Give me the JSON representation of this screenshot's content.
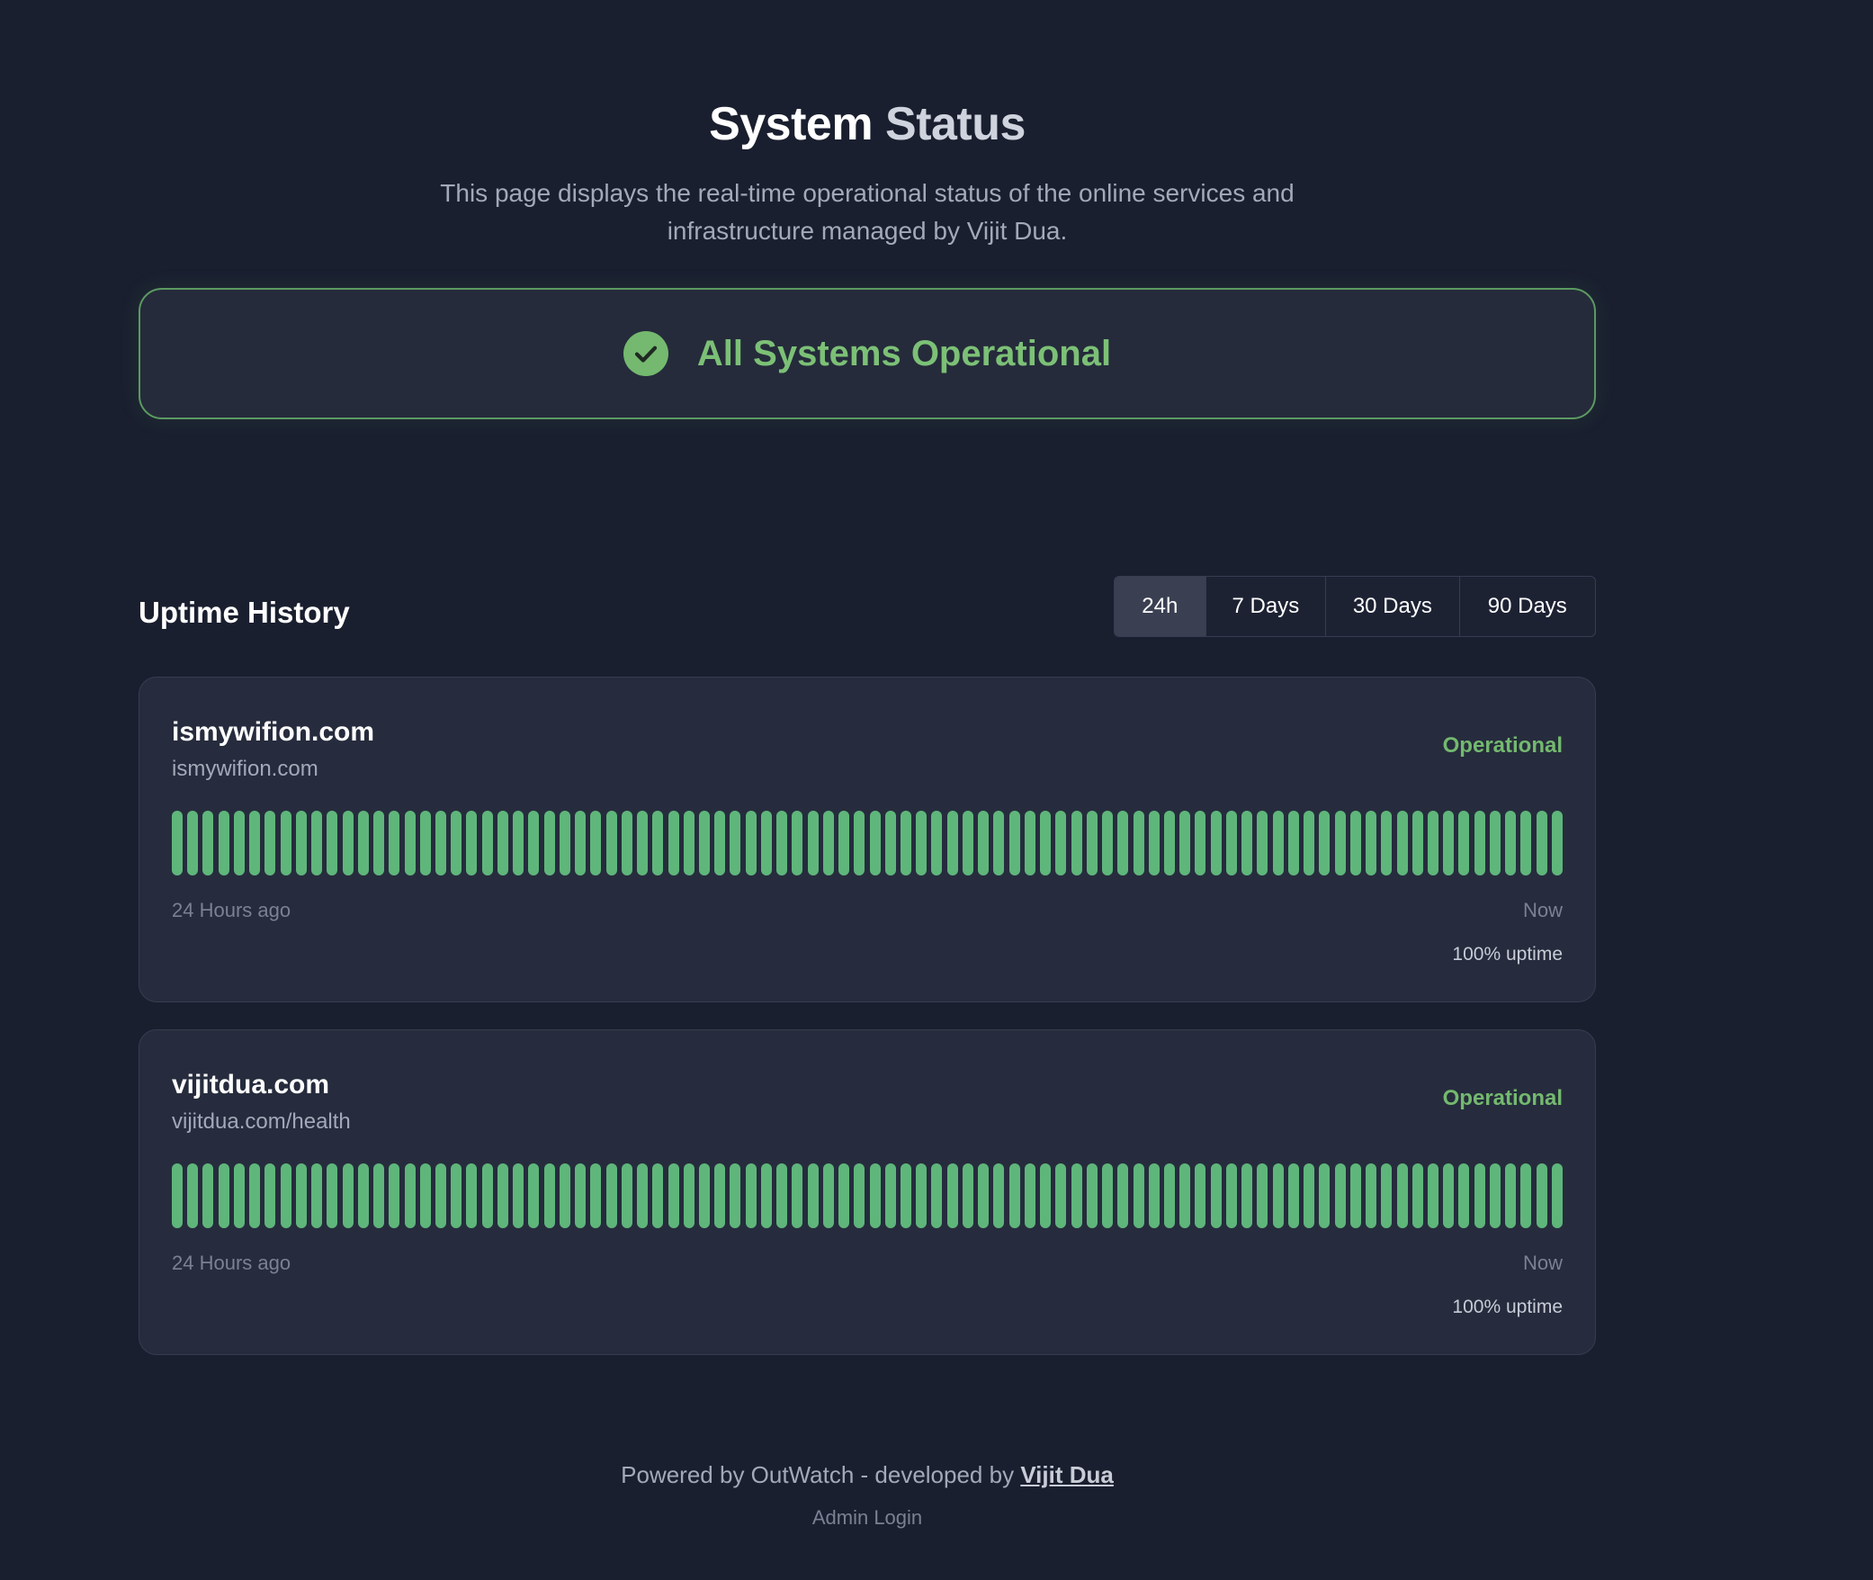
{
  "header": {
    "title_part1": "System",
    "title_part2": "Status",
    "subtitle": "This page displays the real-time operational status of the online services and infrastructure managed by Vijit Dua."
  },
  "banner": {
    "icon": "check-circle-icon",
    "text": "All Systems Operational",
    "color": "#7cc076"
  },
  "uptime_history": {
    "title": "Uptime History",
    "tabs": [
      {
        "label": "24h",
        "active": true
      },
      {
        "label": "7 Days",
        "active": false
      },
      {
        "label": "30 Days",
        "active": false
      },
      {
        "label": "90 Days",
        "active": false
      }
    ]
  },
  "monitors": [
    {
      "name": "ismywifion.com",
      "url": "ismywifion.com",
      "status": "Operational",
      "start_label": "24 Hours ago",
      "end_label": "Now",
      "uptime": "100% uptime",
      "bar_count": 90,
      "bar_color": "#5fb67b"
    },
    {
      "name": "vijitdua.com",
      "url": "vijitdua.com/health",
      "status": "Operational",
      "start_label": "24 Hours ago",
      "end_label": "Now",
      "uptime": "100% uptime",
      "bar_count": 90,
      "bar_color": "#5fb67b"
    }
  ],
  "footer": {
    "powered_text": "Powered by OutWatch - developed by ",
    "author_link": "Vijit Dua",
    "admin_login": "Admin Login"
  }
}
